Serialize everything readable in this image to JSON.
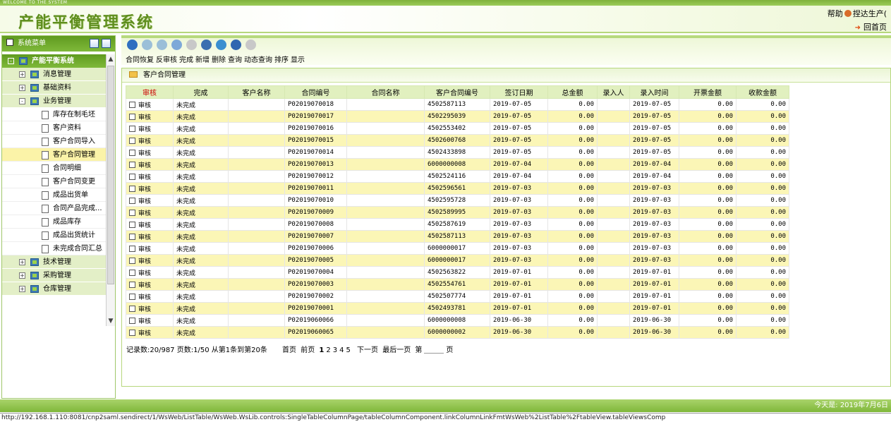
{
  "top_strip": "WELCOME TO THE SYSTEM",
  "header": {
    "title": "产能平衡管理系统",
    "help": "帮助",
    "user": "捏达生产(",
    "home": "回首页"
  },
  "sidebar": {
    "title": "系统菜单",
    "root": "产能平衡系统",
    "groups_top": [
      {
        "label": "消息管理",
        "toggle": "+"
      },
      {
        "label": "基础资料",
        "toggle": "+"
      },
      {
        "label": "业务管理",
        "toggle": "-"
      }
    ],
    "leaves": [
      "库存在制毛坯",
      "客户资料",
      "客户合同导入",
      "客户合同管理",
      "合同明细",
      "客户合同变更",
      "成品出货单",
      "合同产品完成...",
      "成品库存",
      "成品出货统计",
      "未完成合同汇总"
    ],
    "selected_leaf": "客户合同管理",
    "groups_bottom": [
      {
        "label": "技术管理",
        "toggle": "+"
      },
      {
        "label": "采购管理",
        "toggle": "+"
      },
      {
        "label": "仓库管理",
        "toggle": "+"
      }
    ]
  },
  "toolbar": {
    "actions": [
      "合同恢复",
      "反审核",
      "完成",
      "新增",
      "删除",
      "查询",
      "动态查询",
      "排序",
      "显示"
    ],
    "icon_colors": [
      "#2f6fc0",
      "#9bbfd8",
      "#9bbfd8",
      "#7ea9d8",
      "#c8c8c8",
      "#3a6fb0",
      "#3a8fd0",
      "#2f66b0",
      "#c8c8c8"
    ]
  },
  "panel": {
    "title": "客户合同管理",
    "columns": [
      "审核",
      "完成",
      "客户名称",
      "合同编号",
      "合同名称",
      "客户合同编号",
      "签订日期",
      "总金额",
      "录入人",
      "录入时间",
      "开票金额",
      "收款金额"
    ],
    "rows": [
      {
        "audit": "审核",
        "done": "未完成",
        "contract_no": "P02019070018",
        "cust_contract": "4502587113",
        "sign_date": "2019-07-05",
        "total": "0.00",
        "entry_time": "2019-07-05",
        "invoice": "0.00",
        "receipt": "0.00"
      },
      {
        "audit": "审核",
        "done": "未完成",
        "contract_no": "P02019070017",
        "cust_contract": "4502295039",
        "sign_date": "2019-07-05",
        "total": "0.00",
        "entry_time": "2019-07-05",
        "invoice": "0.00",
        "receipt": "0.00"
      },
      {
        "audit": "审核",
        "done": "未完成",
        "contract_no": "P02019070016",
        "cust_contract": "4502553402",
        "sign_date": "2019-07-05",
        "total": "0.00",
        "entry_time": "2019-07-05",
        "invoice": "0.00",
        "receipt": "0.00"
      },
      {
        "audit": "审核",
        "done": "未完成",
        "contract_no": "P02019070015",
        "cust_contract": "4502600768",
        "sign_date": "2019-07-05",
        "total": "0.00",
        "entry_time": "2019-07-05",
        "invoice": "0.00",
        "receipt": "0.00"
      },
      {
        "audit": "审核",
        "done": "未完成",
        "contract_no": "P02019070014",
        "cust_contract": "4502433898",
        "sign_date": "2019-07-05",
        "total": "0.00",
        "entry_time": "2019-07-05",
        "invoice": "0.00",
        "receipt": "0.00"
      },
      {
        "audit": "审核",
        "done": "未完成",
        "contract_no": "P02019070013",
        "cust_contract": "6000000008",
        "sign_date": "2019-07-04",
        "total": "0.00",
        "entry_time": "2019-07-04",
        "invoice": "0.00",
        "receipt": "0.00"
      },
      {
        "audit": "审核",
        "done": "未完成",
        "contract_no": "P02019070012",
        "cust_contract": "4502524116",
        "sign_date": "2019-07-04",
        "total": "0.00",
        "entry_time": "2019-07-04",
        "invoice": "0.00",
        "receipt": "0.00"
      },
      {
        "audit": "审核",
        "done": "未完成",
        "contract_no": "P02019070011",
        "cust_contract": "4502596561",
        "sign_date": "2019-07-03",
        "total": "0.00",
        "entry_time": "2019-07-03",
        "invoice": "0.00",
        "receipt": "0.00"
      },
      {
        "audit": "审核",
        "done": "未完成",
        "contract_no": "P02019070010",
        "cust_contract": "4502595728",
        "sign_date": "2019-07-03",
        "total": "0.00",
        "entry_time": "2019-07-03",
        "invoice": "0.00",
        "receipt": "0.00"
      },
      {
        "audit": "审核",
        "done": "未完成",
        "contract_no": "P02019070009",
        "cust_contract": "4502589995",
        "sign_date": "2019-07-03",
        "total": "0.00",
        "entry_time": "2019-07-03",
        "invoice": "0.00",
        "receipt": "0.00"
      },
      {
        "audit": "审核",
        "done": "未完成",
        "contract_no": "P02019070008",
        "cust_contract": "4502587619",
        "sign_date": "2019-07-03",
        "total": "0.00",
        "entry_time": "2019-07-03",
        "invoice": "0.00",
        "receipt": "0.00"
      },
      {
        "audit": "审核",
        "done": "未完成",
        "contract_no": "P02019070007",
        "cust_contract": "4502587113",
        "sign_date": "2019-07-03",
        "total": "0.00",
        "entry_time": "2019-07-03",
        "invoice": "0.00",
        "receipt": "0.00"
      },
      {
        "audit": "审核",
        "done": "未完成",
        "contract_no": "P02019070006",
        "cust_contract": "6000000017",
        "sign_date": "2019-07-03",
        "total": "0.00",
        "entry_time": "2019-07-03",
        "invoice": "0.00",
        "receipt": "0.00"
      },
      {
        "audit": "审核",
        "done": "未完成",
        "contract_no": "P02019070005",
        "cust_contract": "6000000017",
        "sign_date": "2019-07-03",
        "total": "0.00",
        "entry_time": "2019-07-03",
        "invoice": "0.00",
        "receipt": "0.00"
      },
      {
        "audit": "审核",
        "done": "未完成",
        "contract_no": "P02019070004",
        "cust_contract": "4502563822",
        "sign_date": "2019-07-01",
        "total": "0.00",
        "entry_time": "2019-07-01",
        "invoice": "0.00",
        "receipt": "0.00"
      },
      {
        "audit": "审核",
        "done": "未完成",
        "contract_no": "P02019070003",
        "cust_contract": "4502554761",
        "sign_date": "2019-07-01",
        "total": "0.00",
        "entry_time": "2019-07-01",
        "invoice": "0.00",
        "receipt": "0.00"
      },
      {
        "audit": "审核",
        "done": "未完成",
        "contract_no": "P02019070002",
        "cust_contract": "4502507774",
        "sign_date": "2019-07-01",
        "total": "0.00",
        "entry_time": "2019-07-01",
        "invoice": "0.00",
        "receipt": "0.00"
      },
      {
        "audit": "审核",
        "done": "未完成",
        "contract_no": "P02019070001",
        "cust_contract": "4502493781",
        "sign_date": "2019-07-01",
        "total": "0.00",
        "entry_time": "2019-07-01",
        "invoice": "0.00",
        "receipt": "0.00"
      },
      {
        "audit": "审核",
        "done": "未完成",
        "contract_no": "P02019060066",
        "cust_contract": "6000000008",
        "sign_date": "2019-06-30",
        "total": "0.00",
        "entry_time": "2019-06-30",
        "invoice": "0.00",
        "receipt": "0.00"
      },
      {
        "audit": "审核",
        "done": "未完成",
        "contract_no": "P02019060065",
        "cust_contract": "6000000002",
        "sign_date": "2019-06-30",
        "total": "0.00",
        "entry_time": "2019-06-30",
        "invoice": "0.00",
        "receipt": "0.00"
      }
    ]
  },
  "pager": {
    "summary": "记录数:20/987 页数:1/50 从第1条到第20条",
    "first": "首页",
    "prev": "前页",
    "pages": [
      "1",
      "2",
      "3",
      "4",
      "5"
    ],
    "current_page": "1",
    "next": "下一页",
    "last": "最后一页",
    "goto_prefix": "第",
    "goto_suffix": "页"
  },
  "status": {
    "today": "今天是: 2019年7月6日"
  },
  "url": "http://192.168.1.110:8081/cnp2saml.sendirect/1/WsWeb/ListTable/WsWeb.WsLib.controls:SingleTableColumnPage/tableColumnComponent.linkColumnLinkFmtWsWeb%2ListTable%2FtableView.tableViewsComp"
}
